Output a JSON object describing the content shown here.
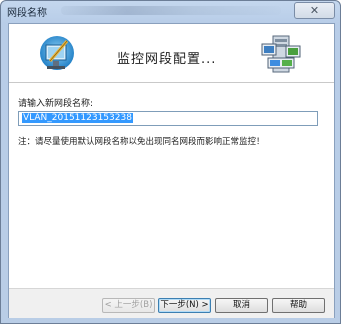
{
  "window": {
    "title": "网段名称",
    "close_glyph": "✕"
  },
  "banner": {
    "title": "监控网段配置...",
    "left_icon": "monitor-with-pen-icon",
    "right_icon": "network-segment-icon"
  },
  "form": {
    "label": "请输入新网段名称:",
    "segment_name_value": "VLAN_20151123153238",
    "note": "注：请尽量使用默认网段名称以免出现同名网段而影响正常监控！"
  },
  "buttons": {
    "back": "< 上一步(B)",
    "next": "下一步(N) >",
    "cancel": "取消",
    "help": "帮助"
  }
}
